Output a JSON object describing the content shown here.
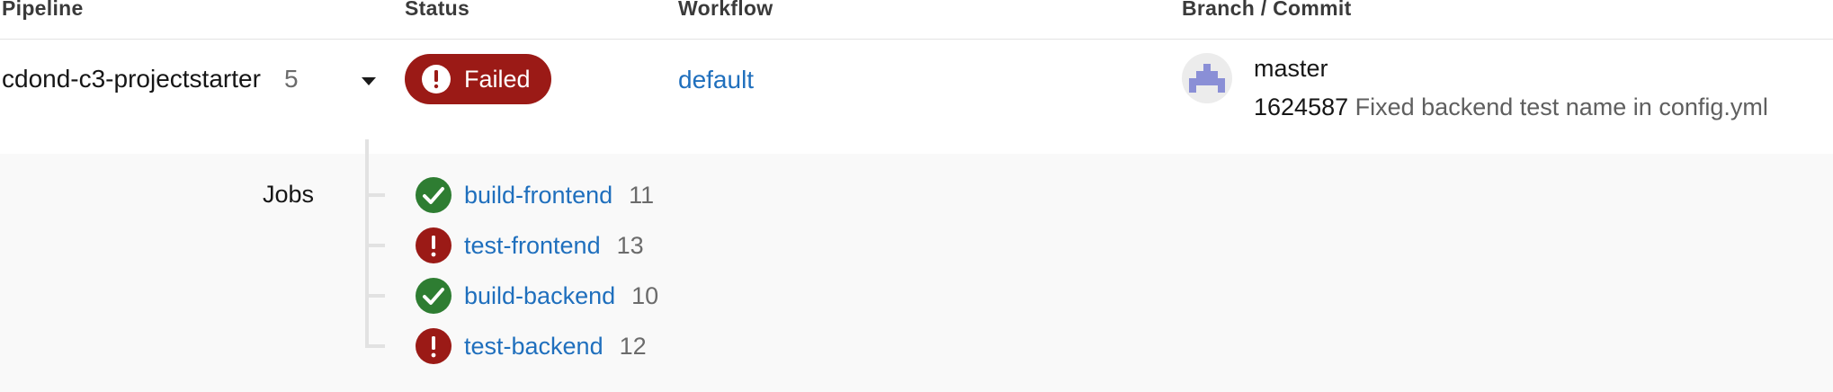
{
  "header": {
    "pipeline": "Pipeline",
    "status": "Status",
    "workflow": "Workflow",
    "branch_commit": "Branch / Commit"
  },
  "pipeline": {
    "name": "cdond-c3-projectstarter",
    "number": "5",
    "status": "Failed",
    "status_icon": "exclamation-circle-icon",
    "workflow": "default",
    "branch": "master",
    "commit_hash": "1624587",
    "commit_message": "Fixed backend test name in config.yml"
  },
  "jobs": {
    "label": "Jobs",
    "items": [
      {
        "name": "build-frontend",
        "number": "11",
        "status": "success",
        "icon": "check-circle-icon"
      },
      {
        "name": "test-frontend",
        "number": "13",
        "status": "failed",
        "icon": "exclamation-circle-icon"
      },
      {
        "name": "build-backend",
        "number": "10",
        "status": "success",
        "icon": "check-circle-icon"
      },
      {
        "name": "test-backend",
        "number": "12",
        "status": "failed",
        "icon": "exclamation-circle-icon"
      }
    ]
  },
  "colors": {
    "failed": "#9b1a16",
    "success": "#2e7d32",
    "link": "#1f6fbd"
  }
}
